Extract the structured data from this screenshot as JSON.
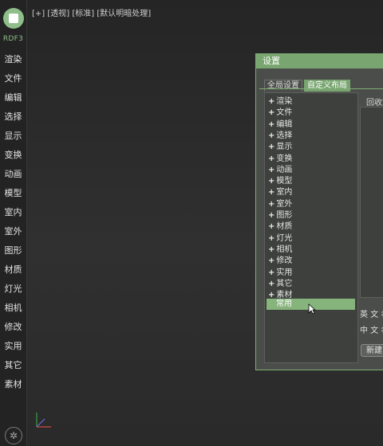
{
  "sidebar": {
    "brand": "RDF3",
    "items": [
      "渲染",
      "文件",
      "编辑",
      "选择",
      "显示",
      "变换",
      "动画",
      "模型",
      "室内",
      "室外",
      "图形",
      "材质",
      "灯光",
      "相机",
      "修改",
      "实用",
      "其它",
      "素材"
    ],
    "logo_icon": "camera-icon",
    "settings_icon": "gear-icon"
  },
  "viewport": {
    "label": "[+] [透视] [标准] [默认明暗处理]"
  },
  "dialog": {
    "title": "设置",
    "tabs": [
      "全局设置",
      "自定义布局"
    ],
    "active_tab": "自定义布局",
    "categories": [
      "渲染",
      "文件",
      "编辑",
      "选择",
      "显示",
      "变换",
      "动画",
      "模型",
      "室内",
      "室外",
      "图形",
      "材质",
      "灯光",
      "相机",
      "修改",
      "实用",
      "其它",
      "素材"
    ],
    "selected_category": "常用",
    "recycle_label": "回收站",
    "english_name_label": "英 文 名",
    "chinese_name_label": "中 文 名",
    "new_button": "新建"
  },
  "colors": {
    "accent": "#79a570",
    "brand": "#8fbe8a",
    "selected": "#86b47c"
  }
}
